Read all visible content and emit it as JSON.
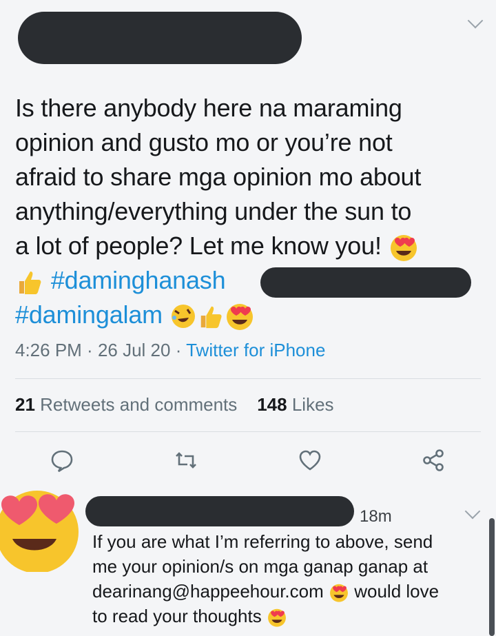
{
  "tweet": {
    "lines": [
      "Is there anybody here na maraming",
      "opinion and gusto mo or you’re not",
      "afraid to share mga opinion mo about",
      "anything/everything under the sun to",
      "a lot of people? Let me know you!"
    ],
    "hashtag1": "#daminghanash",
    "hashtag2": "#damingalam",
    "time": "4:26 PM",
    "date": "26 Jul 20",
    "source": "Twitter for iPhone",
    "sep": " · "
  },
  "stats": {
    "retweets_count": "21",
    "retweets_label": "Retweets and comments",
    "likes_count": "148",
    "likes_label": "Likes"
  },
  "reply": {
    "time": "18m",
    "line1": "If you are what I’m referring to above, send",
    "line2": "me your opinion/s on mga ganap ganap at",
    "email": "dearinang@happeehour.com",
    "line3_tail": "would love",
    "line4": "to read your thoughts"
  },
  "icons": {
    "reply": "comment-icon",
    "retweet": "retweet-icon",
    "like": "heart-icon",
    "share": "share-icon",
    "chevron": "chevron-down-icon"
  },
  "colors": {
    "hashtag": "#1d8fd8",
    "muted": "#627079",
    "redaction": "#2a2d31"
  }
}
